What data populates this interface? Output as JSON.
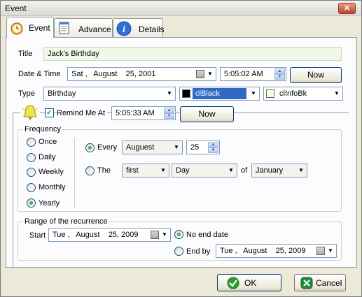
{
  "window": {
    "title": "Event",
    "close_glyph": "✕"
  },
  "tabs": [
    {
      "label": "Event",
      "icon": "alarm-clock-icon"
    },
    {
      "label": "Advance",
      "icon": "notepad-icon"
    },
    {
      "label": "Details",
      "icon": "info-icon"
    }
  ],
  "form": {
    "title_label": "Title",
    "title_value": "Jack's Birthday",
    "datetime_label": "Date & Time",
    "date_value": "Sat ,   August    25, 2001",
    "time_value": "5:05:02 AM",
    "now_label": "Now",
    "type_label": "Type",
    "type_value": "Birthday",
    "color1_value": "clBlack",
    "color2_value": "clInfoBk",
    "remind_label": "Remind Me At",
    "remind_time": "5:05:33 AM",
    "remind_now_label": "Now"
  },
  "frequency": {
    "title": "Frequency",
    "options": [
      "Once",
      "Daily",
      "Weekly",
      "Monthly",
      "Yearly"
    ],
    "selected": "Yearly",
    "every_label": "Every",
    "every_month": "Auguest",
    "every_day": "25",
    "the_label": "The",
    "the_ordinal": "first",
    "the_unit": "Day",
    "of_label": "of",
    "the_month": "January"
  },
  "recurrence": {
    "title": "Range of the recurrence",
    "start_label": "Start",
    "start_value": "Tue ,   August    25, 2009",
    "no_end_label": "No end date",
    "end_by_label": "End by",
    "end_by_value": "Tue ,   August    25, 2009"
  },
  "buttons": {
    "ok": "OK",
    "cancel": "Cancel"
  },
  "colors": {
    "accent_selection": "#316ac5",
    "title_bg": "#f0f8e8"
  }
}
